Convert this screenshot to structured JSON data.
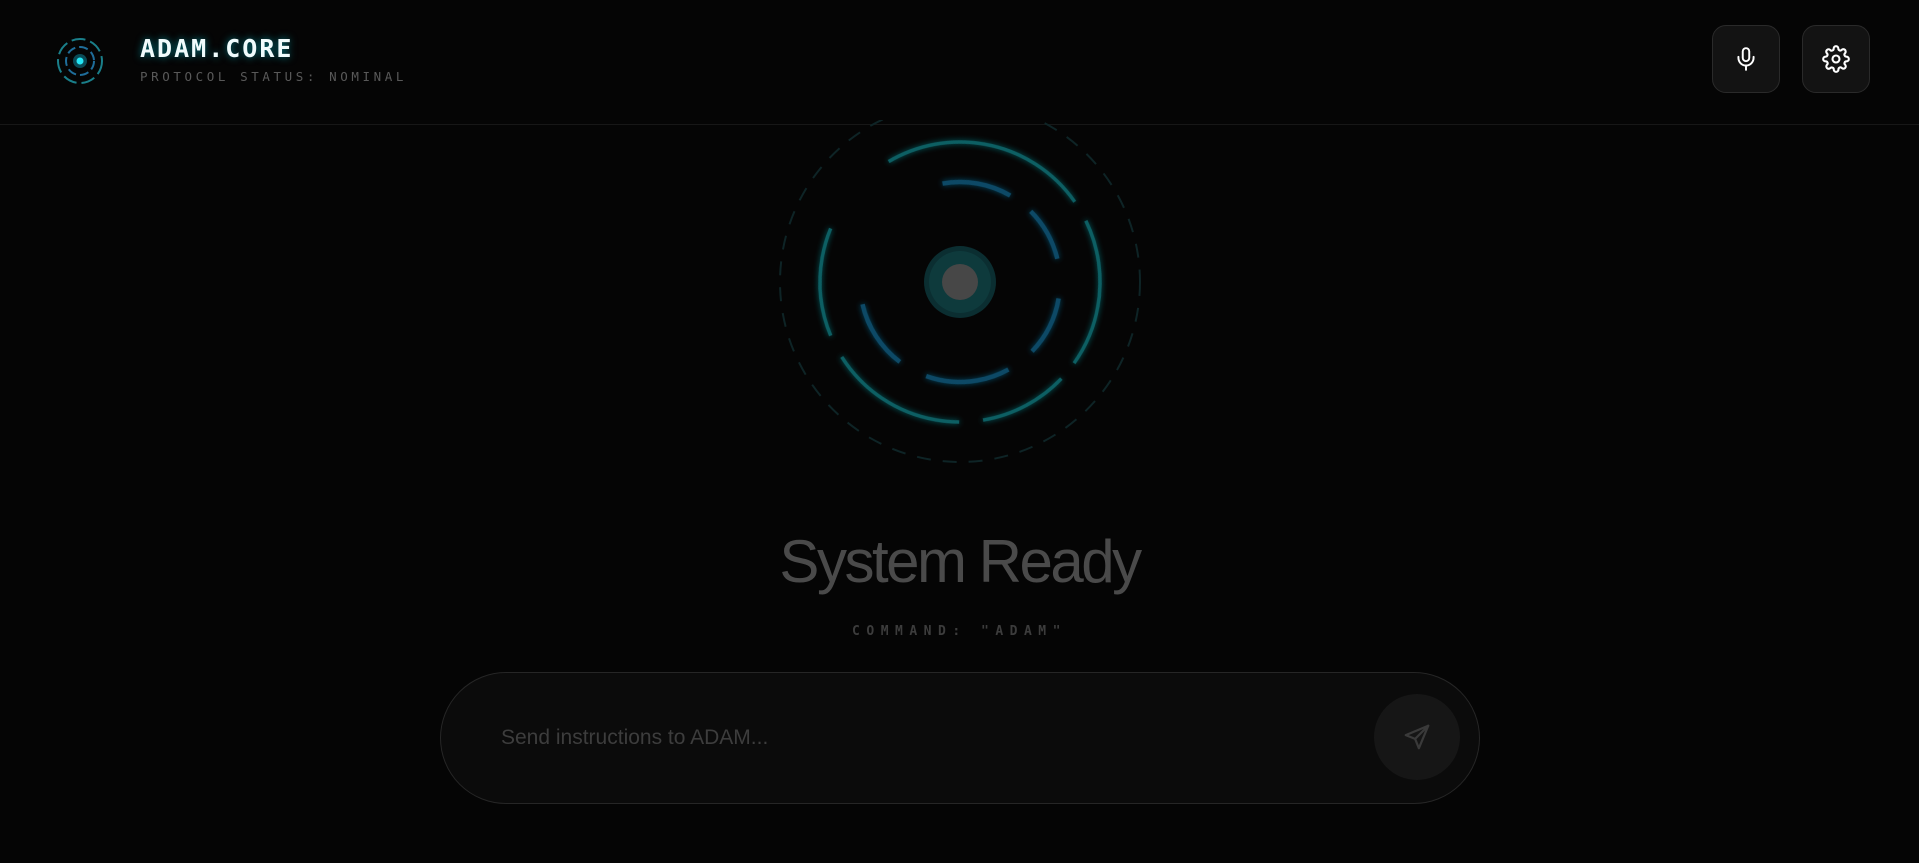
{
  "header": {
    "title": "ADAM.CORE",
    "subtitle": "PROTOCOL STATUS: NOMINAL",
    "logo_icon": "ring-logo-icon",
    "buttons": [
      {
        "name": "mic",
        "icon": "microphone-icon"
      },
      {
        "name": "settings",
        "icon": "gear-icon"
      }
    ]
  },
  "core": {
    "icon": "reactor-core-icon"
  },
  "status": {
    "title": "System Ready",
    "subtitle": "COMMAND: \"ADAM\""
  },
  "command": {
    "placeholder": "Send instructions to ADAM...",
    "value": "",
    "send_icon": "send-icon"
  },
  "colors": {
    "background": "#050505",
    "accent_cyan": "#00c8dc",
    "ring_teal": "#0f5e63",
    "ring_blue": "#0d4a66",
    "core_fill": "#0e3a3c",
    "core_center": "#4a4a4a"
  }
}
